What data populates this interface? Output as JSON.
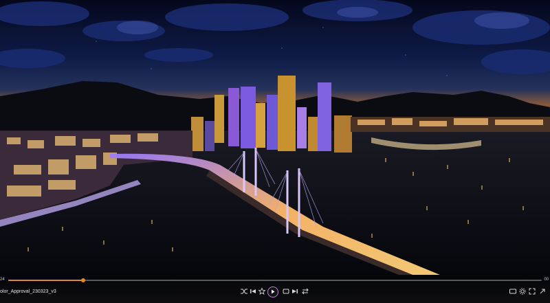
{
  "player": {
    "file_title": "olor_Approval_230323_v3",
    "time_elapsed": "24",
    "time_total": "00",
    "progress": 0.14
  },
  "controls": {
    "icons": [
      "shuffle-icon",
      "previous-icon",
      "bookmark-icon",
      "play-icon",
      "loop-icon",
      "next-icon",
      "repeat-icon"
    ],
    "right_icons": [
      "subtitles-icon",
      "settings-icon",
      "fullscreen-icon",
      "expand-icon"
    ]
  },
  "colors": {
    "accent": "#e08a2c",
    "play_ring": "#c77ad9",
    "sky_top": "#0a1030",
    "sky_horizon": "#c07a3a",
    "water": "#081018"
  }
}
